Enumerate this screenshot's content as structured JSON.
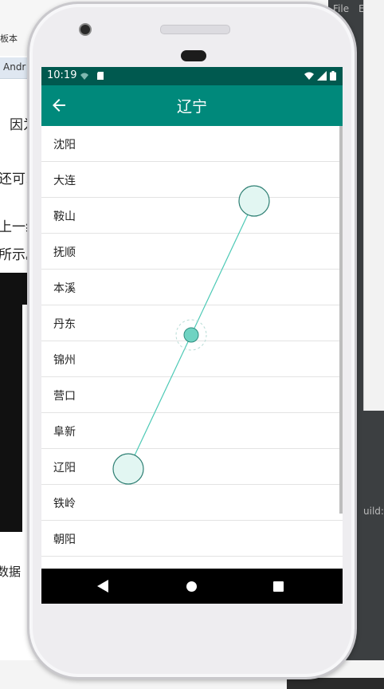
{
  "background": {
    "doc_fragments": [
      "因为",
      "还可以",
      "上一组",
      "所示。",
      "数据"
    ],
    "tab_label": "Andr",
    "small_label": "板本",
    "ide_menu": [
      "File",
      "E"
    ],
    "ide_build": "uild:"
  },
  "phone": {
    "status": {
      "time": "10:19"
    },
    "appbar": {
      "title": "辽宁"
    },
    "cities": [
      "沈阳",
      "大连",
      "鞍山",
      "抚顺",
      "本溪",
      "丹东",
      "锦州",
      "营口",
      "阜新",
      "辽阳",
      "铁岭",
      "朝阳"
    ],
    "nav": {
      "back": "back-nav",
      "home": "home-nav",
      "recent": "recents-nav"
    }
  },
  "colors": {
    "statusbar": "#00594f",
    "appbar": "#00897b",
    "gesture": "#4cc9b5"
  }
}
